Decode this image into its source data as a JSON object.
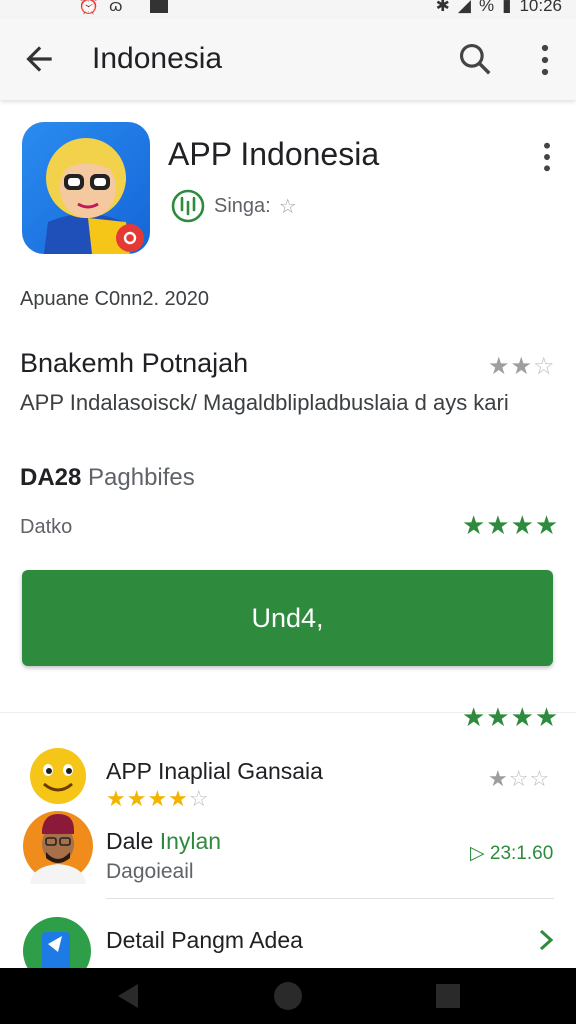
{
  "status_bar": {
    "time": "10:26",
    "icons_left": [
      "alarm-icon",
      "notification-icon"
    ],
    "icons_right": [
      "bluetooth-icon",
      "signal-icon",
      "battery-icon"
    ],
    "percent_symbol": "%"
  },
  "app_bar": {
    "title": "Indonesia",
    "icons": [
      "back-arrow-icon",
      "search-icon",
      "more-vert-icon"
    ]
  },
  "app": {
    "name": "APP Indonesia",
    "developer": "Singa:",
    "developer_star": "☆",
    "updated": "Apuane C0nn2. 2020"
  },
  "section": {
    "title": "Bnakemh Potnajah",
    "rating": {
      "filled": 2,
      "total": 3
    },
    "description": "APP Indalasoisck/ Magaldblipladbuslaia d ays kari",
    "size_bold": "DA28",
    "size_text": "Paghbifes",
    "label": "Datko",
    "label_rating": {
      "filled": 4,
      "total": 4
    }
  },
  "install_button": {
    "label": "Und4,"
  },
  "reviews": {
    "rating": {
      "filled": 4,
      "total": 4
    },
    "related_app": {
      "title": "APP Inaplial Gansaia",
      "rating_gold": {
        "filled": 4,
        "total": 5
      },
      "rating_right": {
        "filled": 1,
        "total": 3
      }
    },
    "person": {
      "name_first": "Dale",
      "name_second": "Inylan",
      "subtitle": "Dagoieail",
      "time": "▷ 23:1.60"
    }
  },
  "detail": {
    "label": "Detail Pangm Adea"
  },
  "nav": {
    "icons": [
      "nav-back-icon",
      "nav-home-icon",
      "nav-recents-icon"
    ]
  },
  "colors": {
    "accent_green": "#2e8b3d",
    "star_gold": "#f2b400",
    "app_icon_blue": "#1e7be6"
  }
}
